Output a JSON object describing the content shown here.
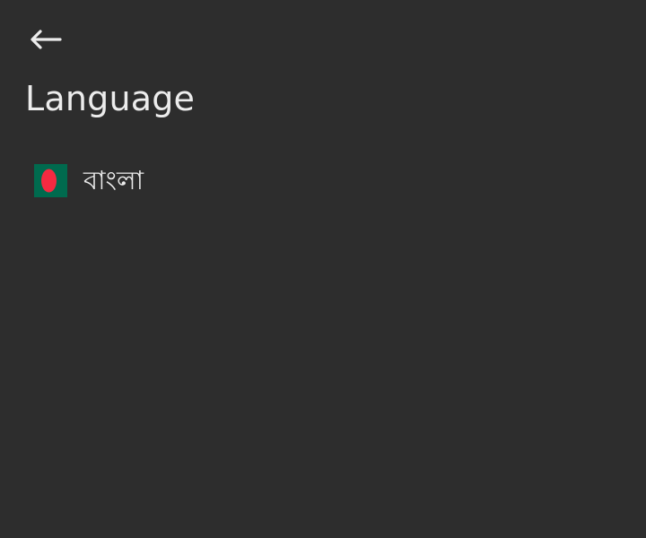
{
  "page": {
    "title": "Language",
    "background_color": "#2d2d2d",
    "text_color": "#ececec"
  },
  "header": {
    "back_icon": "arrow-left-icon"
  },
  "languages": [
    {
      "label": "বাংলা",
      "flag_icon": "bangladesh-flag-icon",
      "flag_colors": {
        "field": "#006a4e",
        "disc": "#f42a41"
      }
    }
  ]
}
